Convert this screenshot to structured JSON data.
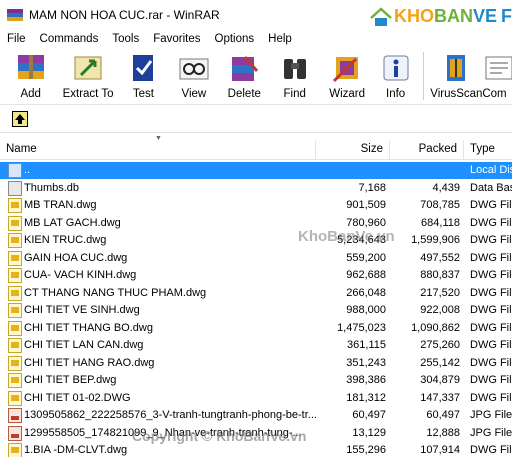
{
  "window": {
    "title": "MAM NON HOA CUC.rar - WinRAR"
  },
  "watermark": {
    "logo": "KHOBANVE",
    "logo_partial": "F",
    "center": "KhoBanVe.vn",
    "bottom": "Copyright © KhoBanVe.vn"
  },
  "menu": [
    "File",
    "Commands",
    "Tools",
    "Favorites",
    "Options",
    "Help"
  ],
  "toolbar": {
    "add": "Add",
    "extract": "Extract To",
    "test": "Test",
    "view": "View",
    "delete": "Delete",
    "find": "Find",
    "wizard": "Wizard",
    "info": "Info",
    "virusscan": "VirusScan",
    "comment": "Com"
  },
  "columns": {
    "name": "Name",
    "size": "Size",
    "packed": "Packed",
    "type": "Type"
  },
  "rows": [
    {
      "name": "..",
      "size": "",
      "packed": "",
      "type": "Local Disk",
      "icon": "folder-up-icon"
    },
    {
      "name": "Thumbs.db",
      "size": "7,168",
      "packed": "4,439",
      "type": "Data Base",
      "icon": "db-file-icon"
    },
    {
      "name": "MB TRAN.dwg",
      "size": "901,509",
      "packed": "708,785",
      "type": "DWG File",
      "icon": "dwg-file-icon"
    },
    {
      "name": "MB LAT GACH.dwg",
      "size": "780,960",
      "packed": "684,118",
      "type": "DWG File",
      "icon": "dwg-file-icon"
    },
    {
      "name": "KIEN TRUC.dwg",
      "size": "5,234,643",
      "packed": "1,599,906",
      "type": "DWG File",
      "icon": "dwg-file-icon"
    },
    {
      "name": "GAIN HOA CUC.dwg",
      "size": "559,200",
      "packed": "497,552",
      "type": "DWG File",
      "icon": "dwg-file-icon"
    },
    {
      "name": "CUA- VACH KINH.dwg",
      "size": "962,688",
      "packed": "880,837",
      "type": "DWG File",
      "icon": "dwg-file-icon"
    },
    {
      "name": "CT THANG NANG THUC PHAM.dwg",
      "size": "266,048",
      "packed": "217,520",
      "type": "DWG File",
      "icon": "dwg-file-icon"
    },
    {
      "name": "CHI TIET VE SINH.dwg",
      "size": "988,000",
      "packed": "922,008",
      "type": "DWG File",
      "icon": "dwg-file-icon"
    },
    {
      "name": "CHI TIET THANG BO.dwg",
      "size": "1,475,023",
      "packed": "1,090,862",
      "type": "DWG File",
      "icon": "dwg-file-icon"
    },
    {
      "name": "CHI TIET LAN CAN.dwg",
      "size": "361,115",
      "packed": "275,260",
      "type": "DWG File",
      "icon": "dwg-file-icon"
    },
    {
      "name": "CHI TIET HANG RAO.dwg",
      "size": "351,243",
      "packed": "255,142",
      "type": "DWG File",
      "icon": "dwg-file-icon"
    },
    {
      "name": "CHI TIET BEP.dwg",
      "size": "398,386",
      "packed": "304,879",
      "type": "DWG File",
      "icon": "dwg-file-icon"
    },
    {
      "name": "CHI TIET 01-02.DWG",
      "size": "181,312",
      "packed": "147,337",
      "type": "DWG File",
      "icon": "dwg-file-icon"
    },
    {
      "name": "1309505862_222258576_3-V-tranh-tungtranh-phong-be-tr...",
      "size": "60,497",
      "packed": "60,497",
      "type": "JPG File",
      "icon": "jpg-file-icon"
    },
    {
      "name": "1299558505_174821099_9_Nhan-ve-tranh-tranh-tung-...",
      "size": "13,129",
      "packed": "12,888",
      "type": "JPG File",
      "icon": "jpg-file-icon"
    },
    {
      "name": "1.BIA -DM-CLVT.dwg",
      "size": "155,296",
      "packed": "107,914",
      "type": "DWG File",
      "icon": "dwg-file-icon"
    }
  ]
}
